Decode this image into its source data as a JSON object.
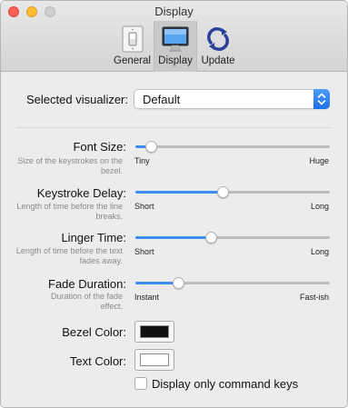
{
  "window": {
    "title": "Display"
  },
  "toolbar": {
    "tabs": [
      {
        "label": "General",
        "icon": "light-switch-icon"
      },
      {
        "label": "Display",
        "icon": "monitor-icon",
        "selected": true
      },
      {
        "label": "Update",
        "icon": "sync-arrows-icon"
      }
    ]
  },
  "visualizer": {
    "label": "Selected visualizer:",
    "value": "Default"
  },
  "settings": {
    "font_size": {
      "label": "Font Size:",
      "description": "Size of the keystrokes on the bezel.",
      "min_label": "Tiny",
      "max_label": "Huge",
      "value": 0.08
    },
    "keystroke_delay": {
      "label": "Keystroke Delay:",
      "description": "Length of time before the line breaks.",
      "min_label": "Short",
      "max_label": "Long",
      "value": 0.45
    },
    "linger_time": {
      "label": "Linger Time:",
      "description": "Length of time before the text fades away.",
      "min_label": "Short",
      "max_label": "Long",
      "value": 0.39
    },
    "fade_duration": {
      "label": "Fade Duration:",
      "description": "Duration of the fade effect.",
      "min_label": "Instant",
      "max_label": "Fast-ish",
      "value": 0.22
    }
  },
  "colors": {
    "bezel": {
      "label": "Bezel Color:",
      "value": "#111111"
    },
    "text": {
      "label": "Text Color:",
      "value": "#ffffff"
    },
    "accent": "#3b8ef0"
  },
  "options": {
    "command_keys_label": "Display only command keys",
    "command_keys_checked": false
  }
}
